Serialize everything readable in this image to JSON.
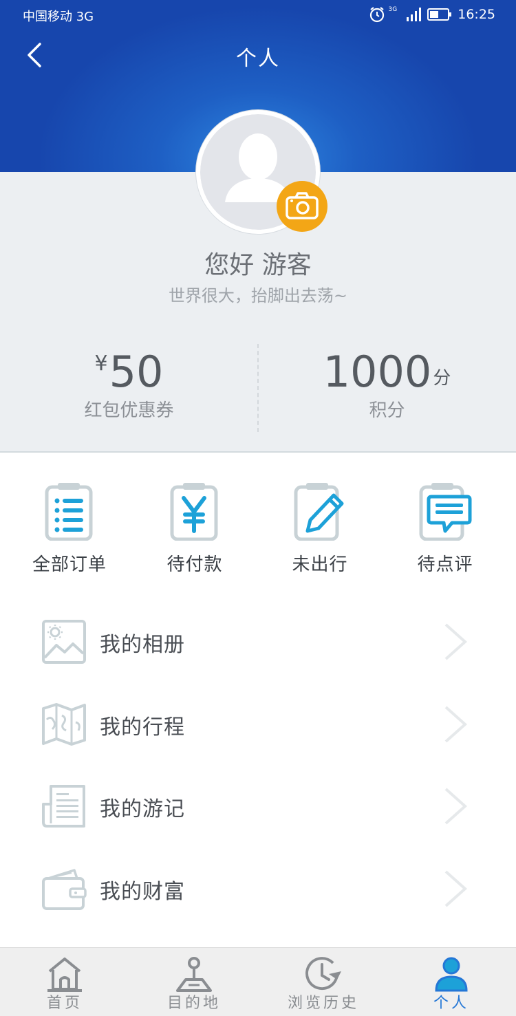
{
  "status_bar": {
    "carrier": "中国移动 3G",
    "network_badge": "3G",
    "time": "16:25",
    "icons": [
      "alarm-icon",
      "signal-icon",
      "battery-icon"
    ]
  },
  "nav": {
    "title": "个人",
    "back_icon": "chevron-left-icon"
  },
  "profile": {
    "greeting": "您好 游客",
    "slogan": "世界很大，抬脚出去荡~",
    "avatar_icon": "user-avatar-icon",
    "camera_icon": "camera-icon"
  },
  "stats": {
    "coupon": {
      "prefix": "¥",
      "value": "50",
      "label": "红包优惠券"
    },
    "points": {
      "value": "1000",
      "suffix": "分",
      "label": "积分"
    }
  },
  "orders": [
    {
      "label": "全部订单",
      "icon": "order-list-icon"
    },
    {
      "label": "待付款",
      "icon": "yen-payment-icon"
    },
    {
      "label": "未出行",
      "icon": "pencil-edit-icon"
    },
    {
      "label": "待点评",
      "icon": "comment-icon"
    }
  ],
  "menu": [
    {
      "label": "我的相册",
      "icon": "photo-album-icon"
    },
    {
      "label": "我的行程",
      "icon": "map-icon"
    },
    {
      "label": "我的游记",
      "icon": "travel-notes-icon"
    },
    {
      "label": "我的财富",
      "icon": "wallet-icon"
    }
  ],
  "tab_bar": {
    "tabs": [
      {
        "label": "首页",
        "icon": "home-icon"
      },
      {
        "label": "目的地",
        "icon": "destination-icon"
      },
      {
        "label": "浏览历史",
        "icon": "history-icon"
      },
      {
        "label": "个人",
        "icon": "person-icon"
      }
    ],
    "active_index": 3
  },
  "colors": {
    "header_blue": "#1e5fc4",
    "accent_orange": "#f3a616",
    "icon_teal": "#1da1d8",
    "icon_gray": "#c8d2d6",
    "active_tab": "#2477d6"
  }
}
